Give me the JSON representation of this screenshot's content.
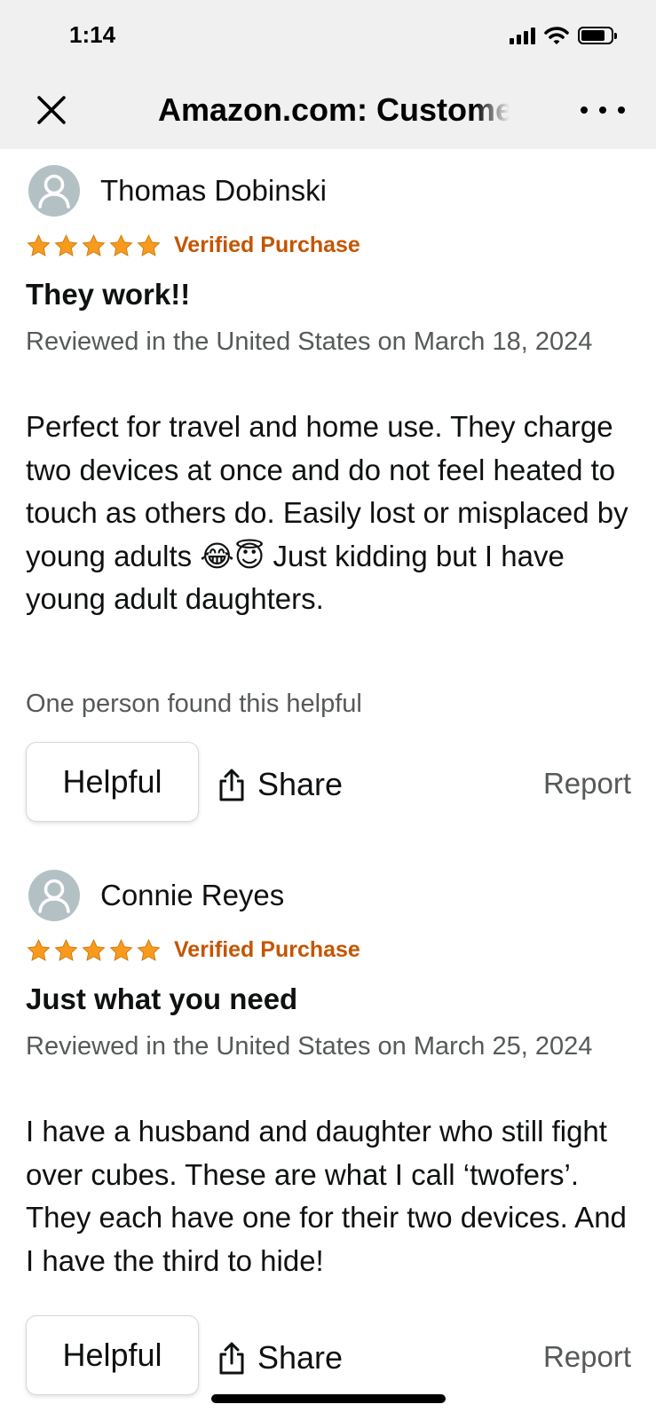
{
  "status_bar": {
    "time": "1:14"
  },
  "nav": {
    "title": "Amazon.com: Customer Reviews"
  },
  "icons": {
    "close": "close-icon",
    "more": "more-icon",
    "star": "star-icon",
    "avatar": "avatar-icon",
    "share": "share-icon"
  },
  "colors": {
    "star": "#f79a1d",
    "verified": "#c45500",
    "secondary_text": "#565959",
    "avatar": "#b3c1c4"
  },
  "reviews": [
    {
      "reviewer": "Thomas Dobinski",
      "rating": 5,
      "verified": "Verified Purchase",
      "title": "They work!!",
      "date": "Reviewed in the United States on March 18, 2024",
      "body": "Perfect for travel and home use. They charge two devices at once and do not feel heated to touch as others do. Easily lost or misplaced by young adults 😂😇 Just kidding but I have young adult daughters.",
      "helpful_count": "One person found this helpful",
      "helpful_label": "Helpful",
      "share_label": "Share",
      "report_label": "Report"
    },
    {
      "reviewer": "Connie Reyes",
      "rating": 5,
      "verified": "Verified Purchase",
      "title": "Just what you need",
      "date": "Reviewed in the United States on March 25, 2024",
      "body": "I have a husband and daughter who still fight over cubes. These are what I call ‘twofers’. They each have one for their two devices. And I have the third to hide!",
      "helpful_label": "Helpful",
      "share_label": "Share",
      "report_label": "Report"
    }
  ]
}
